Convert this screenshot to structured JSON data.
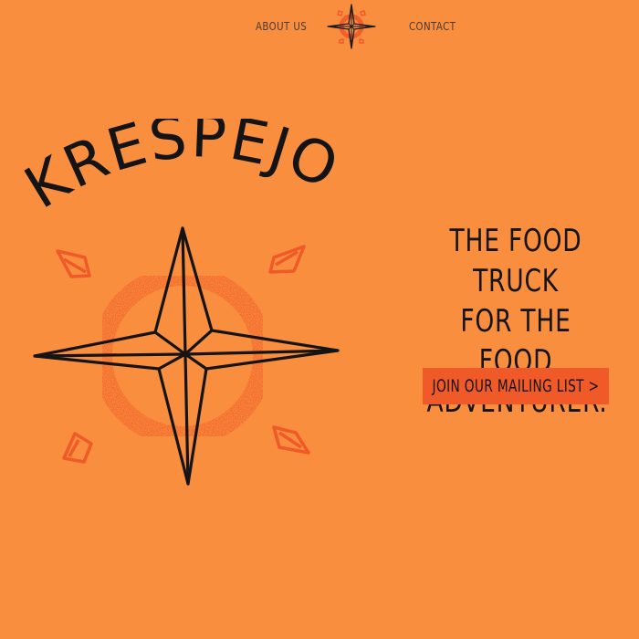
{
  "nav": {
    "about_label": "About us",
    "contact_label": "Contact"
  },
  "hero": {
    "brand_name": "KRESPEJO",
    "tagline_lines": [
      "The food truck",
      "for the food",
      "adventurer."
    ],
    "cta_label": "Join our mailing list >"
  },
  "colors": {
    "background": "#f98e3e",
    "accent": "#f05a28",
    "ink": "#141414"
  },
  "icons": {
    "logo": "compass-star-icon",
    "decorations": "diamond-icon"
  }
}
